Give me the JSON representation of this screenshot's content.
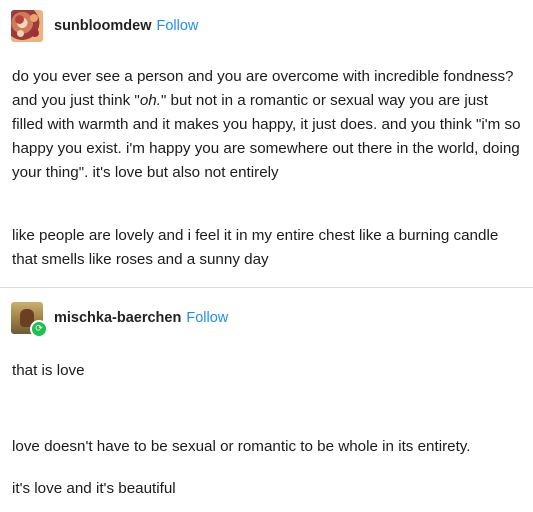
{
  "posts": [
    {
      "username": "sunbloomdew",
      "follow_label": "Follow",
      "paragraphs": [
        {
          "before_em": "do you ever see a person and you are overcome with incredible fondness? and you just think \"",
          "em": "oh.",
          "after_em": "\" but not in a romantic or sexual way you are just filled with warmth and it makes you happy, it just does. and you think \"i'm so happy you exist. i'm happy you are somewhere out there in the world, doing your thing\". it's love but also not entirely"
        },
        {
          "text": "like people are lovely and i feel it in my entire chest like a burning candle that smells like roses and a sunny day"
        }
      ]
    },
    {
      "username": "mischka-baerchen",
      "follow_label": "Follow",
      "reblog_icon": "reblog-icon",
      "paragraphs": [
        {
          "text": "that is love"
        },
        {
          "text": "love doesn't have to be sexual or romantic to be whole in its entirety."
        },
        {
          "text": "it's love and it's beautiful"
        }
      ]
    }
  ],
  "colors": {
    "follow": "#1e8ff0",
    "reblog_badge": "#1fbf53",
    "divider": "#dcdcdc"
  }
}
